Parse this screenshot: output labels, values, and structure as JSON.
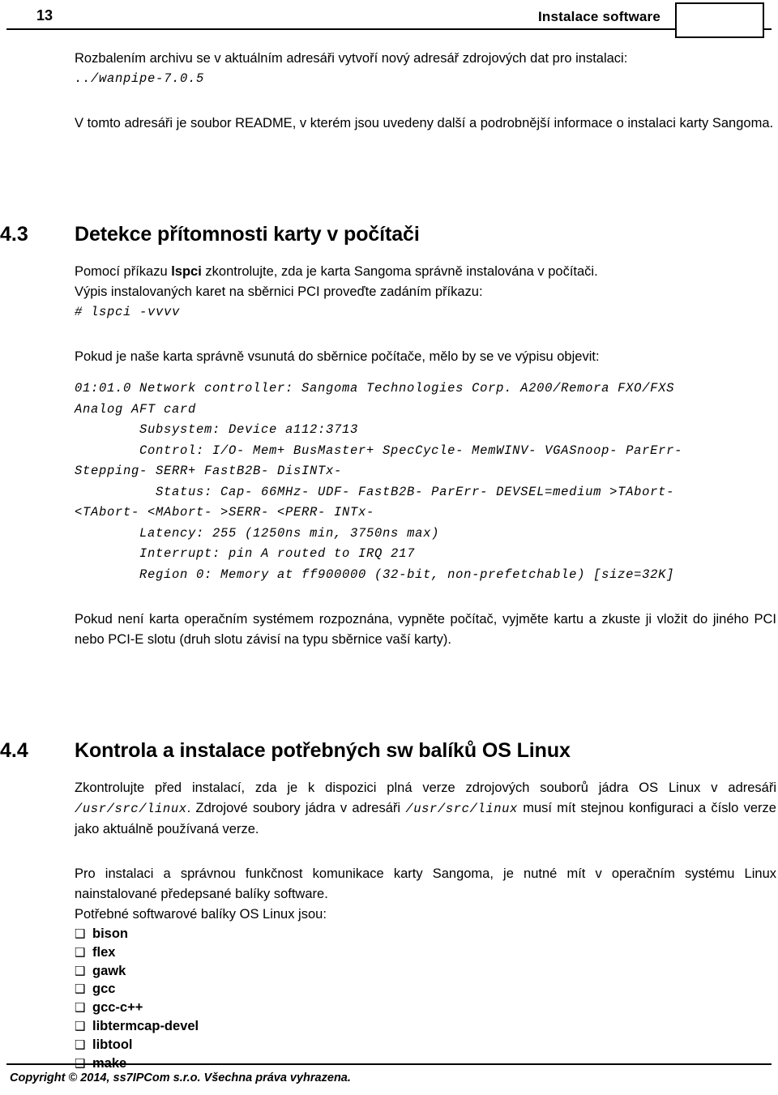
{
  "header": {
    "title": "Instalace software",
    "page_number": "13"
  },
  "footer": {
    "copyright": "Copyright © 2014, ss7IPCom s.r.o. Všechna práva vyhrazena."
  },
  "intro": {
    "unpack_text": "Rozbalením archivu se v aktuálním adresáři vytvoří nový adresář zdrojových dat pro instalaci:",
    "unpack_path": "../wanpipe-7.0.5",
    "readme_text": "V tomto adresáři je soubor README, v kterém jsou uvedeny další a podrobnější informace o instalaci karty Sangoma."
  },
  "section_43": {
    "number": "4.3",
    "title": "Detekce přítomnosti karty v počítači",
    "intro_a": "Pomocí příkazu ",
    "intro_bold": "lspci",
    "intro_b": " zkontrolujte, zda je karta Sangoma správně instalována v počítači.",
    "intro_line2": "Výpis instalovaných karet na sběrnici PCI proveďte zadáním příkazu:",
    "command": "# lspci -vvvv",
    "expect_text": "Pokud je naše karta správně vsunutá do sběrnice počítače, mělo by se ve výpisu objevit:",
    "lspci_output": "01:01.0 Network controller: Sangoma Technologies Corp. A200/Remora FXO/FXS\nAnalog AFT card\n        Subsystem: Device a112:3713\n        Control: I/O- Mem+ BusMaster+ SpecCycle- MemWINV- VGASnoop- ParErr-\nStepping- SERR+ FastB2B- DisINTx-\n          Status: Cap- 66MHz- UDF- FastB2B- ParErr- DEVSEL=medium >TAbort-\n<TAbort- <MAbort- >SERR- <PERR- INTx-\n        Latency: 255 (1250ns min, 3750ns max)\n        Interrupt: pin A routed to IRQ 217\n        Region 0: Memory at ff900000 (32-bit, non-prefetchable) [size=32K]",
    "not_detected_text": "Pokud není karta operačním systémem rozpoznána, vypněte počítač, vyjměte kartu a zkuste ji vložit do jiného PCI nebo PCI-E slotu (druh slotu závisí na typu sběrnice vaší karty)."
  },
  "section_44": {
    "number": "4.4",
    "title": "Kontrola a instalace potřebných sw balíků OS Linux",
    "kernel_a": "Zkontrolujte před instalací, zda je k dispozici plná verze zdrojových souborů jádra OS Linux v adresáři ",
    "kernel_path1": "/usr/src/linux",
    "kernel_b": ". Zdrojové soubory jádra v adresáři ",
    "kernel_path2": "/usr/src/linux",
    "kernel_c": " musí mít stejnou konfiguraci a číslo verze jako aktuálně používaná verze.",
    "packages_intro": "Pro instalaci a správnou funkčnost komunikace karty Sangoma, je nutné mít v operačním systému Linux nainstalované předepsané balíky software.",
    "packages_label": "Potřebné softwarové balíky OS Linux jsou:",
    "bullet_glyph": "❑",
    "packages": [
      "bison",
      "flex",
      "gawk",
      "gcc",
      "gcc-c++",
      "libtermcap-devel",
      "libtool",
      "make"
    ]
  }
}
